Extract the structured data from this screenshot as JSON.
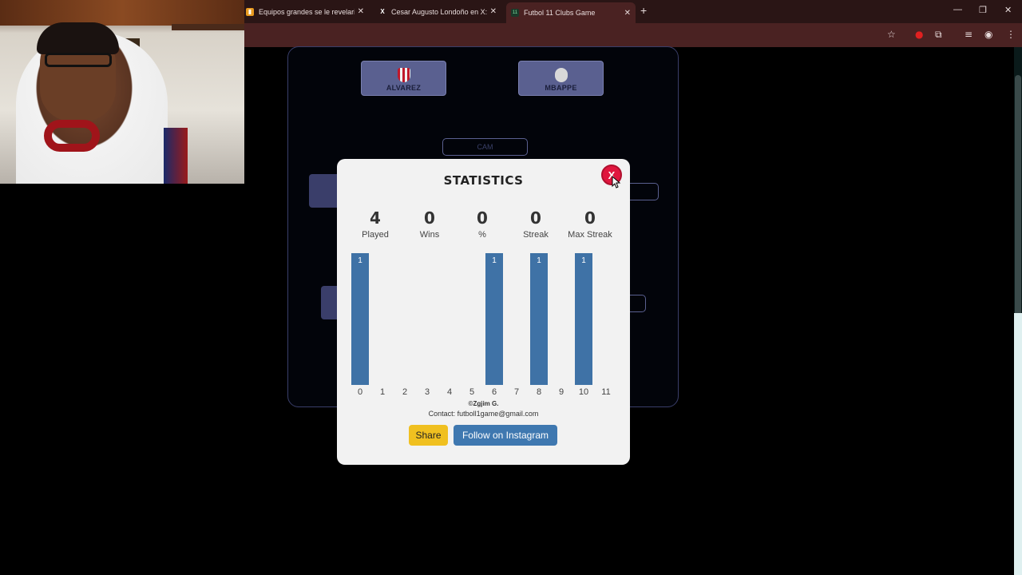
{
  "browser": {
    "tabs": [
      {
        "label": "Equipos grandes se le revelaria",
        "icon": "bookmark-icon",
        "active": false
      },
      {
        "label": "Cesar Augusto Londoño en X: '",
        "icon": "x-logo-icon",
        "active": false
      },
      {
        "label": "Futbol 11 Clubs Game",
        "icon": "futbol11-icon",
        "active": true
      }
    ],
    "new_tab_symbol": "+",
    "window_controls": {
      "minimize": "—",
      "restore": "❐",
      "close": "✕"
    }
  },
  "board": {
    "players": [
      {
        "name": "ALVAREZ",
        "crest_color": "#c0182a"
      },
      {
        "name": "MBAPPE",
        "crest_color": "#d8d8d8"
      }
    ],
    "slot_cam": "CAM"
  },
  "modal": {
    "title": "STATISTICS",
    "close_label": "X",
    "stats": [
      {
        "value": "4",
        "label": "Played"
      },
      {
        "value": "0",
        "label": "Wins"
      },
      {
        "value": "0",
        "label": "%"
      },
      {
        "value": "0",
        "label": "Streak"
      },
      {
        "value": "0",
        "label": "Max Streak"
      }
    ],
    "copyright": "©Zgjim G.",
    "contact": "Contact: futboll1game@gmail.com",
    "share_label": "Share",
    "instagram_label": "Follow on Instagram"
  },
  "chart_data": {
    "type": "bar",
    "categories": [
      "0",
      "1",
      "2",
      "3",
      "4",
      "5",
      "6",
      "7",
      "8",
      "9",
      "10",
      "11"
    ],
    "values": [
      1,
      0,
      0,
      0,
      0,
      0,
      1,
      0,
      1,
      0,
      1,
      0
    ],
    "bar_color": "#3f72a6",
    "ylim": [
      0,
      1
    ]
  }
}
